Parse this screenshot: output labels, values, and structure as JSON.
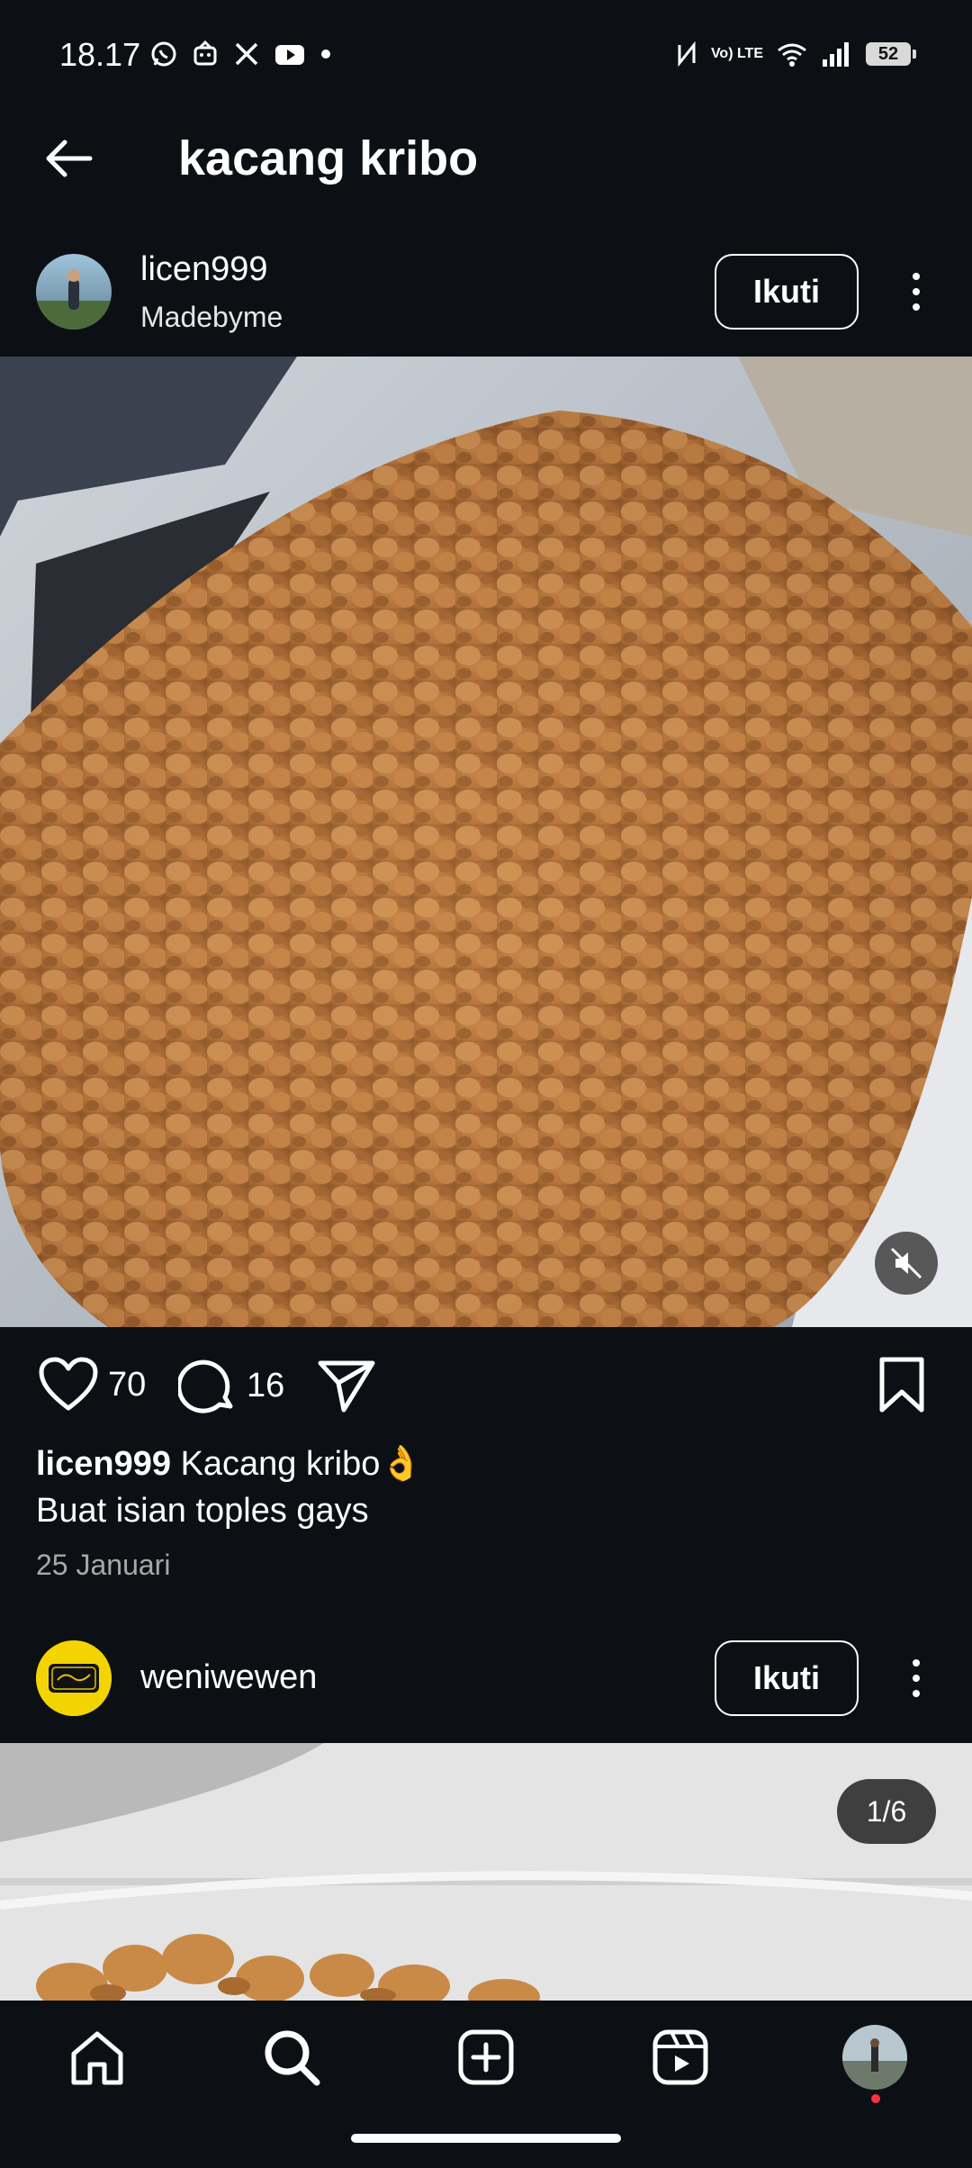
{
  "status_bar": {
    "time": "18.17",
    "left_icons": [
      "whatsapp-icon",
      "notification-app-icon",
      "x-icon",
      "youtube-icon",
      "dot-icon"
    ],
    "right_icons": [
      "nfc-icon",
      "volte-icon",
      "wifi-icon",
      "signal-icon",
      "battery-icon"
    ],
    "volte_label": "Vo) LTE",
    "battery": "52"
  },
  "header": {
    "title": "kacang kribo"
  },
  "post1": {
    "username": "licen999",
    "subtitle": "Madebyme",
    "follow_label": "Ikuti",
    "likes": "70",
    "comments": "16",
    "caption_user": "licen999",
    "caption_line1": "Kacang kribo👌",
    "caption_line2": "Buat isian toples gays",
    "date": "25 Januari"
  },
  "post2": {
    "username": "weniwewen",
    "follow_label": "Ikuti",
    "image_counter": "1/6"
  },
  "bottom_nav": {
    "items": [
      "home-icon",
      "search-icon",
      "create-icon",
      "reels-icon",
      "profile-avatar"
    ]
  },
  "colors": {
    "background": "#0c1014",
    "text": "#f5f5f5",
    "muted": "#a8a8a8",
    "notification_dot": "#ff3040"
  }
}
